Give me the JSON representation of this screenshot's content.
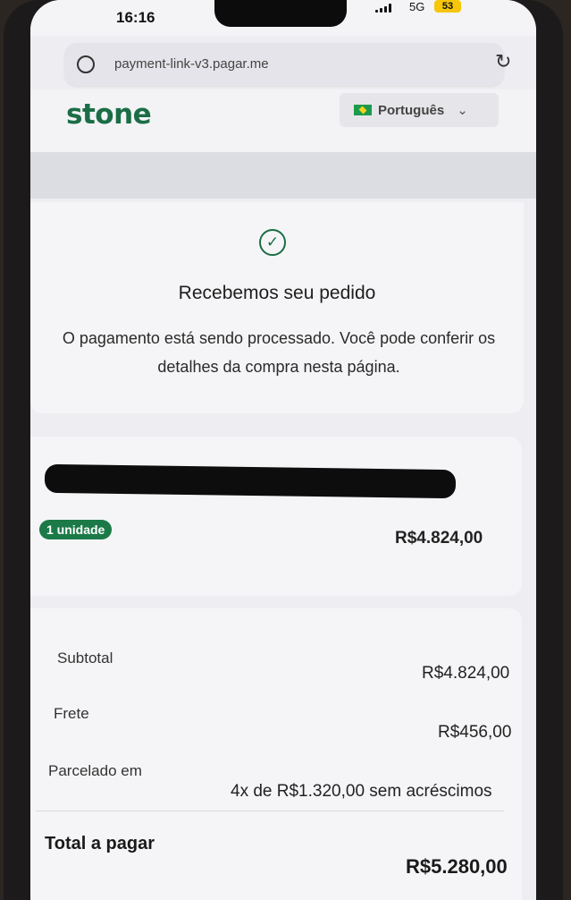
{
  "status_bar": {
    "time": "16:16",
    "network": "5G",
    "battery": "53"
  },
  "browser": {
    "url": "payment-link-v3.pagar.me"
  },
  "header": {
    "logo": "stone",
    "language": "Português"
  },
  "confirmation": {
    "title": "Recebemos seu pedido",
    "message": "O pagamento está sendo processado. Você pode conferir os detalhes da compra nesta página."
  },
  "item": {
    "quantity_badge": "1 unidade",
    "price": "R$4.824,00"
  },
  "summary": {
    "subtotal_label": "Subtotal",
    "subtotal_value": "R$4.824,00",
    "shipping_label": "Frete",
    "shipping_value": "R$456,00",
    "installments_label": "Parcelado em",
    "installments_value": "4x de R$1.320,00 sem acréscimos",
    "total_label": "Total a pagar",
    "total_value": "R$5.280,00"
  },
  "colors": {
    "brand": "#1b6d45",
    "badge": "#1b7a47"
  }
}
